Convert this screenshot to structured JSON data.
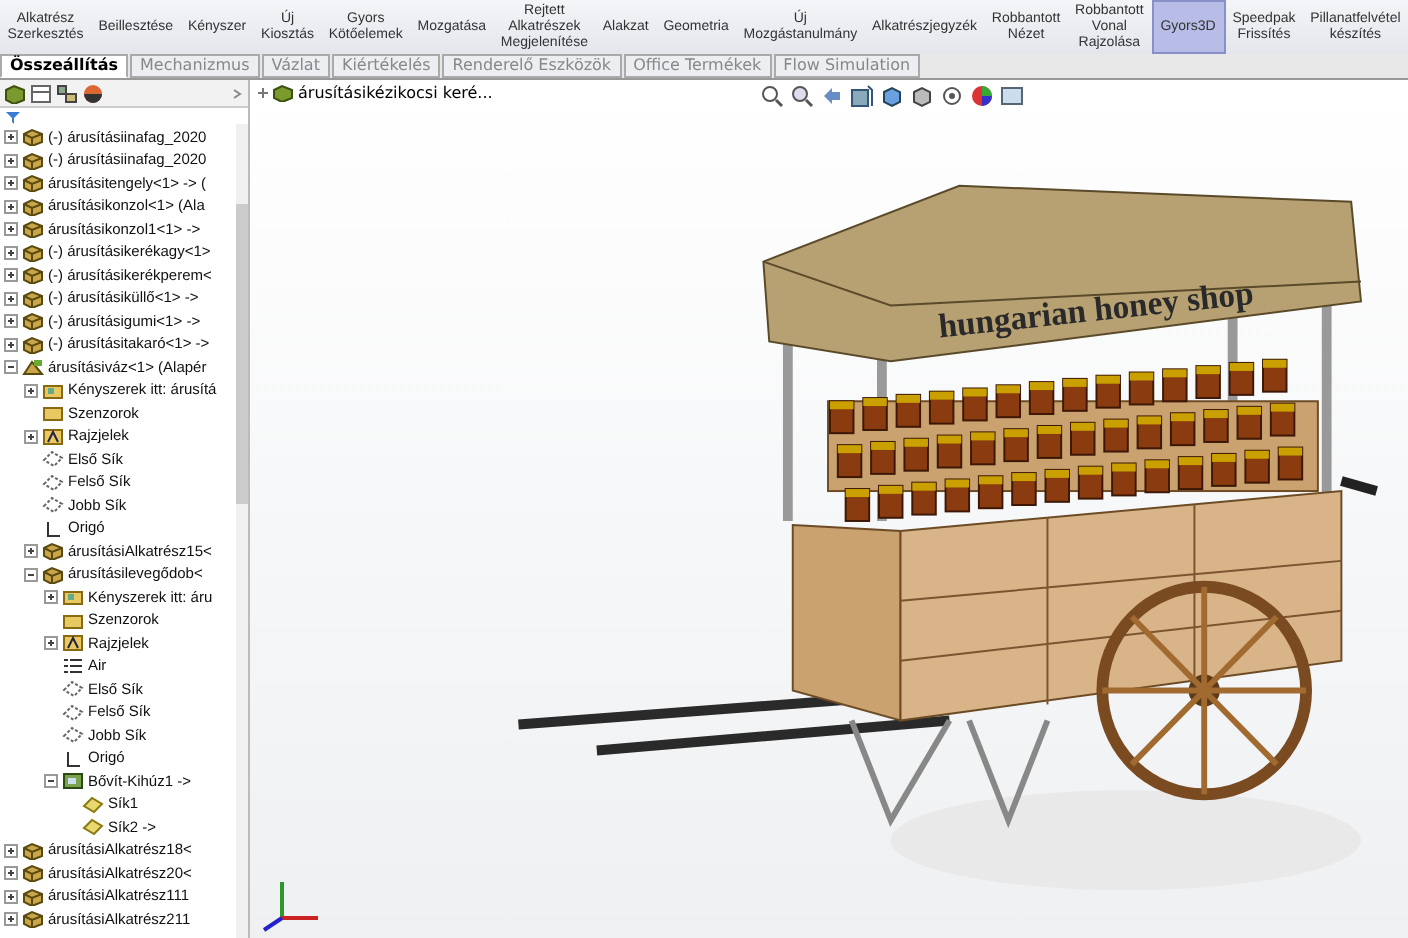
{
  "toolbar": [
    {
      "label": "Alkatrész Szerkesztés",
      "selected": false
    },
    {
      "label": "Beillesztése",
      "selected": false
    },
    {
      "label": "Kényszer",
      "selected": false
    },
    {
      "label": "Új Kiosztás",
      "selected": false
    },
    {
      "label": "Gyors Kötőelemek",
      "selected": false
    },
    {
      "label": "Mozgatása",
      "selected": false
    },
    {
      "label": "Rejtett Alkatrészek Megjelenítése",
      "selected": false
    },
    {
      "label": "Alakzat",
      "selected": false
    },
    {
      "label": "Geometria",
      "selected": false
    },
    {
      "label": "Új Mozgástanulmány",
      "selected": false
    },
    {
      "label": "Alkatrészjegyzék",
      "selected": false
    },
    {
      "label": "Robbantott Nézet",
      "selected": false
    },
    {
      "label": "Robbantott Vonal Rajzolása",
      "selected": false
    },
    {
      "label": "Gyors3D",
      "selected": true
    },
    {
      "label": "Speedpak Frissítés",
      "selected": false
    },
    {
      "label": "Pillanatfelvétel készítés",
      "selected": false
    }
  ],
  "tabs": [
    {
      "label": "Összeállítás",
      "selected": true
    },
    {
      "label": "Mechanizmus",
      "selected": false
    },
    {
      "label": "Vázlat",
      "selected": false
    },
    {
      "label": "Kiértékelés",
      "selected": false
    },
    {
      "label": "Renderelő Eszközök",
      "selected": false
    },
    {
      "label": "Office Termékek",
      "selected": false
    },
    {
      "label": "Flow Simulation",
      "selected": false
    }
  ],
  "viewport": {
    "breadcrumb": "árusításikézikocsi keré...",
    "sign_text": "hungarian honey shop"
  },
  "tree": [
    {
      "label": "(-) árusításiinafag_2020",
      "kind": "part",
      "expanded": false
    },
    {
      "label": "(-) árusításiinafag_2020",
      "kind": "part",
      "expanded": false
    },
    {
      "label": "árusításitengely<1> -> (",
      "kind": "part",
      "expanded": false
    },
    {
      "label": "árusításikonzol<1> (Ala",
      "kind": "part",
      "expanded": false
    },
    {
      "label": "árusításikonzol1<1> ->",
      "kind": "part",
      "expanded": false
    },
    {
      "label": "(-) árusításikerékagy<1>",
      "kind": "part",
      "expanded": false
    },
    {
      "label": "(-) árusításikerékperem<",
      "kind": "part",
      "expanded": false
    },
    {
      "label": "(-) árusításiküllő<1> ->",
      "kind": "part",
      "expanded": false
    },
    {
      "label": "(-) árusításigumi<1> ->",
      "kind": "part",
      "expanded": false
    },
    {
      "label": "(-) árusításitakaró<1> ->",
      "kind": "part",
      "expanded": false
    },
    {
      "label": "árusításiváz<1> (Alapér",
      "kind": "assembly",
      "expanded": true,
      "children": [
        {
          "label": "Kényszerek itt: árusítá",
          "kind": "folder",
          "expanded": false
        },
        {
          "label": "Szenzorok",
          "kind": "sensor"
        },
        {
          "label": "Rajzjelek",
          "kind": "annotation",
          "expanded": false
        },
        {
          "label": "Első Sík",
          "kind": "plane"
        },
        {
          "label": "Felső Sík",
          "kind": "plane"
        },
        {
          "label": "Jobb Sík",
          "kind": "plane"
        },
        {
          "label": "Origó",
          "kind": "origin"
        },
        {
          "label": "árusításiAlkatrész15<",
          "kind": "part",
          "expanded": false
        },
        {
          "label": "árusításilevegődob<",
          "kind": "part",
          "expanded": true,
          "children": [
            {
              "label": "Kényszerek itt: áru",
              "kind": "folder",
              "expanded": false
            },
            {
              "label": "Szenzorok",
              "kind": "sensor"
            },
            {
              "label": "Rajzjelek",
              "kind": "annotation",
              "expanded": false
            },
            {
              "label": "Air",
              "kind": "material"
            },
            {
              "label": "Első Sík",
              "kind": "plane"
            },
            {
              "label": "Felső Sík",
              "kind": "plane"
            },
            {
              "label": "Jobb Sík",
              "kind": "plane"
            },
            {
              "label": "Origó",
              "kind": "origin"
            },
            {
              "label": "Bővít-Kihúz1 ->",
              "kind": "feature",
              "expanded": true,
              "children": [
                {
                  "label": "Sík1",
                  "kind": "sketch"
                },
                {
                  "label": "Sík2 ->",
                  "kind": "sketch"
                }
              ]
            }
          ]
        }
      ]
    },
    {
      "label": "árusításiAlkatrész18<",
      "kind": "part",
      "expanded": false
    },
    {
      "label": "árusításiAlkatrész20<",
      "kind": "part",
      "expanded": false
    },
    {
      "label": "árusításiAlkatrész111",
      "kind": "part",
      "expanded": false
    },
    {
      "label": "árusításiAlkatrész211",
      "kind": "part",
      "expanded": false
    }
  ]
}
